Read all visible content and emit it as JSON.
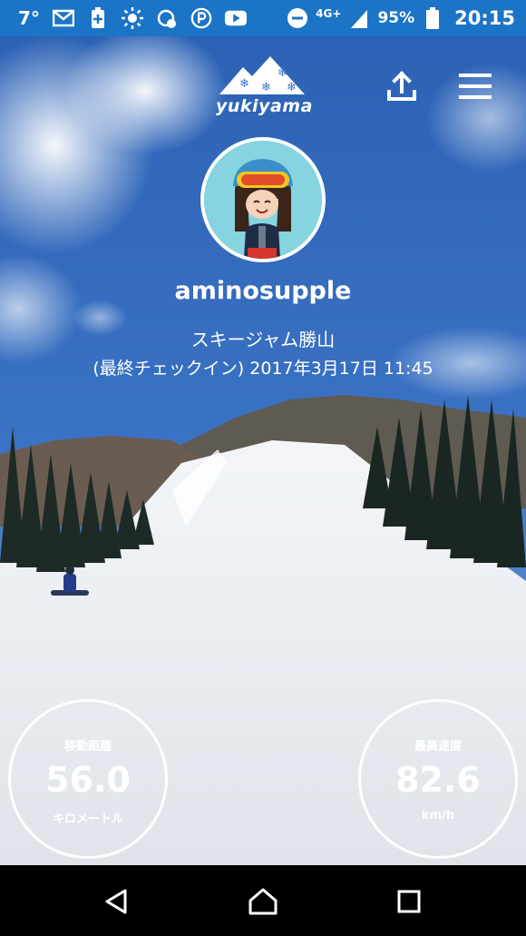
{
  "status_bar": {
    "temperature": "7°",
    "network": "4G+",
    "battery": "95%",
    "time": "20:15",
    "icons": [
      "gmail-icon",
      "battery-saver-icon",
      "brightness-icon",
      "weather-icon",
      "parking-icon",
      "youtube-icon",
      "do-not-disturb-icon",
      "signal-icon",
      "battery-icon"
    ]
  },
  "header": {
    "logo_text": "yukiyama",
    "share_icon": "share-upload-icon",
    "menu_icon": "hamburger-menu-icon"
  },
  "profile": {
    "username": "aminosupple",
    "resort": "スキージャム勝山",
    "last_checkin": "(最終チェックイン) 2017年3月17日 11:45"
  },
  "stats": {
    "distance": {
      "label": "移動距離",
      "value": "56.0",
      "unit": "キロメートル"
    },
    "max_speed": {
      "label": "最高速度",
      "value": "82.6",
      "unit": "km/h"
    }
  },
  "nav_bar": {
    "back_icon": "back-triangle-icon",
    "home_icon": "home-icon",
    "recent_icon": "recent-apps-icon"
  }
}
